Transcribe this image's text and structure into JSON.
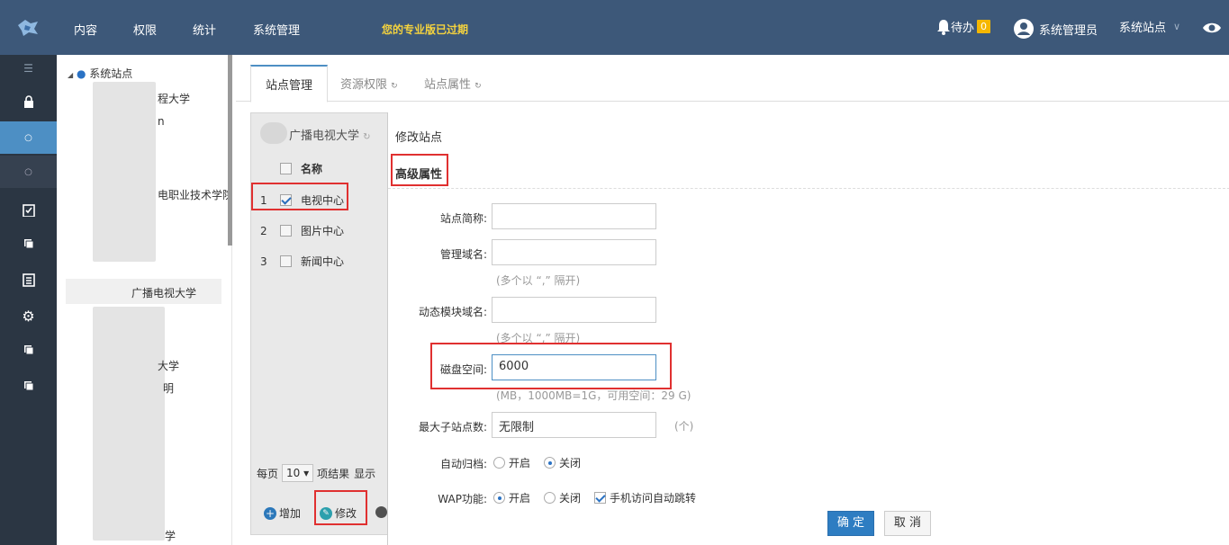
{
  "header": {
    "nav": [
      "内容",
      "权限",
      "统计",
      "系统管理"
    ],
    "expired_notice": "您的专业版已过期",
    "todo_label": "待办",
    "todo_count": "0",
    "user_name": "系统管理员",
    "site_label": "系统站点"
  },
  "tree": {
    "root": "系统站点",
    "nodes": [
      "程大学",
      "n",
      "电职业技术学院",
      "广播电视大学",
      "大学",
      "明",
      "学"
    ]
  },
  "tabs": [
    "站点管理",
    "资源权限",
    "站点属性"
  ],
  "list": {
    "site_name": "广播电视大学",
    "col_name": "名称",
    "rows": [
      {
        "num": "1",
        "name": "电视中心",
        "checked": true
      },
      {
        "num": "2",
        "name": "图片中心",
        "checked": false
      },
      {
        "num": "3",
        "name": "新闻中心",
        "checked": false
      }
    ],
    "per_page_label": "每页",
    "per_page_value": "10",
    "per_page_suffix": "项结果",
    "show_label": "显示",
    "add_label": "增加",
    "edit_label": "修改"
  },
  "dialog": {
    "title": "修改站点",
    "section": "高级属性",
    "fields": {
      "short_name_label": "站点简称:",
      "admin_domain_label": "管理域名:",
      "admin_domain_hint": "(多个以 “,” 隔开)",
      "dynamic_domain_label": "动态模块域名:",
      "dynamic_domain_hint": "(多个以 “,” 隔开)",
      "disk_label": "磁盘空间:",
      "disk_value": "6000",
      "disk_hint": "(MB，1000MB=1G，可用空间：29 G)",
      "max_sub_label": "最大子站点数:",
      "max_sub_value": "无限制",
      "max_sub_unit": "(个)",
      "auto_archive_label": "自动归档:",
      "auto_archive_on": "开启",
      "auto_archive_off": "关闭",
      "wap_label": "WAP功能:",
      "wap_on": "开启",
      "wap_off": "关闭",
      "wap_redirect": "手机访问自动跳转"
    },
    "confirm_label": "确 定",
    "cancel_label": "取 消"
  },
  "colors": {
    "header": "#3d5879",
    "sidebar": "#2b3643",
    "accent": "#2e7dc2",
    "highlight": "#e03030",
    "notice": "#f5d33e"
  }
}
